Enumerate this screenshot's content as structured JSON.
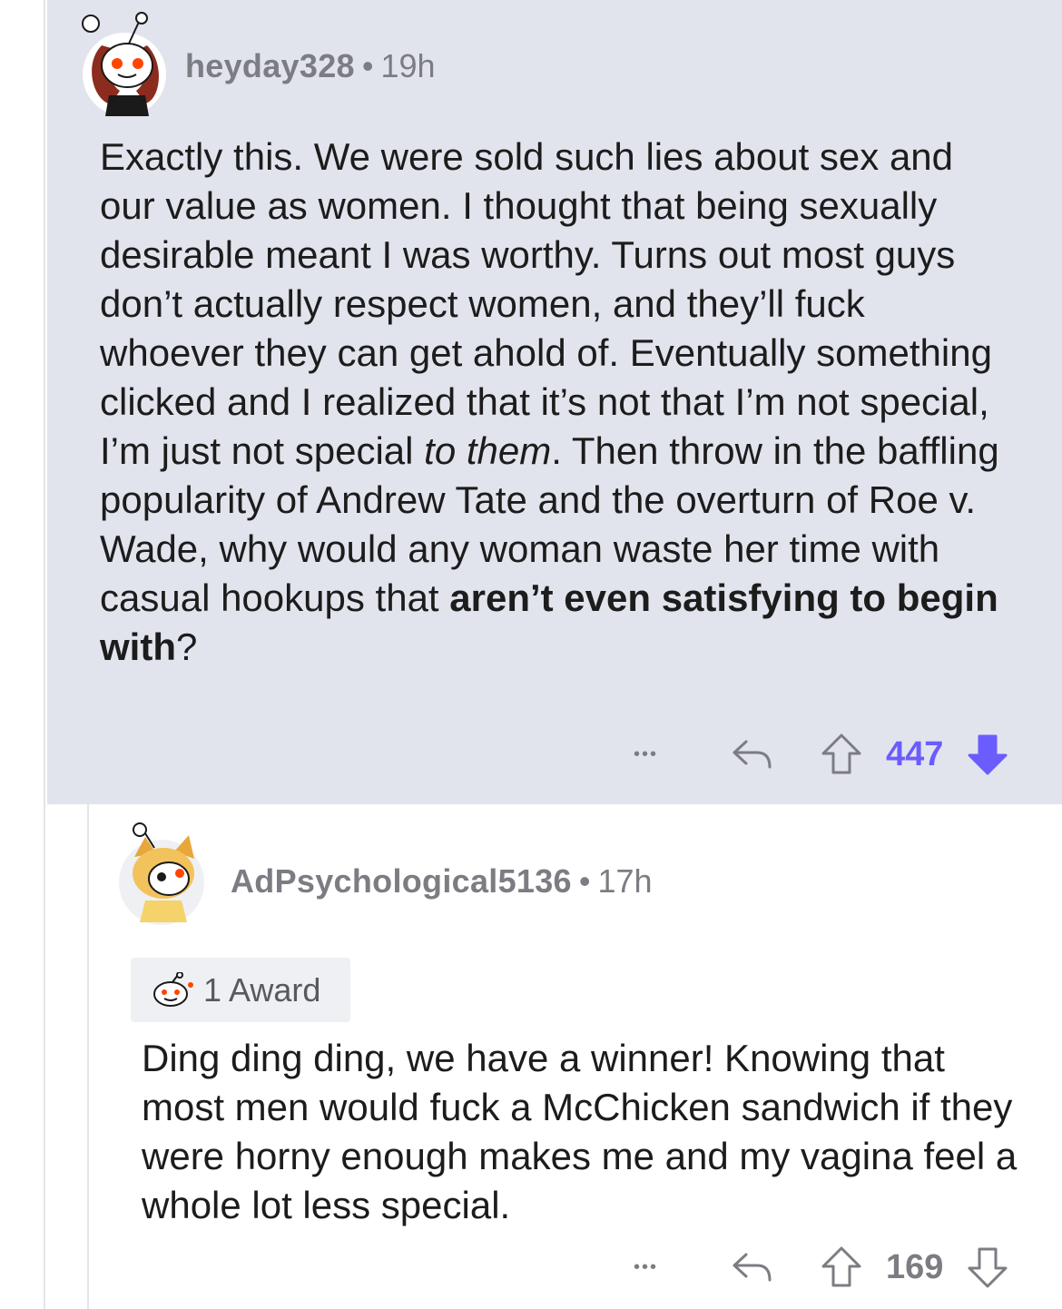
{
  "comments": [
    {
      "username": "heyday328",
      "separator": "•",
      "time": "19h",
      "avatar_icon": "snoo-avatar-woman-icon",
      "text_parts": [
        {
          "t": "Exactly this. We were sold such lies about sex and our value as women. I thought that being sexually desirable meant I was worthy. Turns out most guys don’t actually respect women, and they’ll fuck whoever they can get ahold of. Eventually something clicked and I realized that it’s not that I’m not special, I’m just not special ",
          "s": "normal"
        },
        {
          "t": "to them",
          "s": "italic"
        },
        {
          "t": ". Then throw in the baffling popularity of Andrew Tate and the overturn of Roe v. Wade, why would any woman waste her time with casual hookups that ",
          "s": "normal"
        },
        {
          "t": "aren’t even satisfying to begin with",
          "s": "bold"
        },
        {
          "t": "?",
          "s": "normal"
        }
      ],
      "more_label": "•••",
      "score": "447",
      "vote_state": "downvoted",
      "score_color": "#6a5cff",
      "highlight_bg": "#e2e4ed"
    },
    {
      "username": "AdPsychological5136",
      "separator": "•",
      "time": "17h",
      "avatar_icon": "snoo-avatar-doge-icon",
      "award_label": "1 Award",
      "award_icon": "wholesome-award-icon",
      "text": "Ding ding ding, we have a winner! Knowing that most men would fuck a McChicken sandwich if they were horny enough makes me and my vagina feel a whole lot less special.",
      "more_label": "•••",
      "score": "169",
      "vote_state": "none",
      "score_color": "#7c7c83"
    }
  ]
}
